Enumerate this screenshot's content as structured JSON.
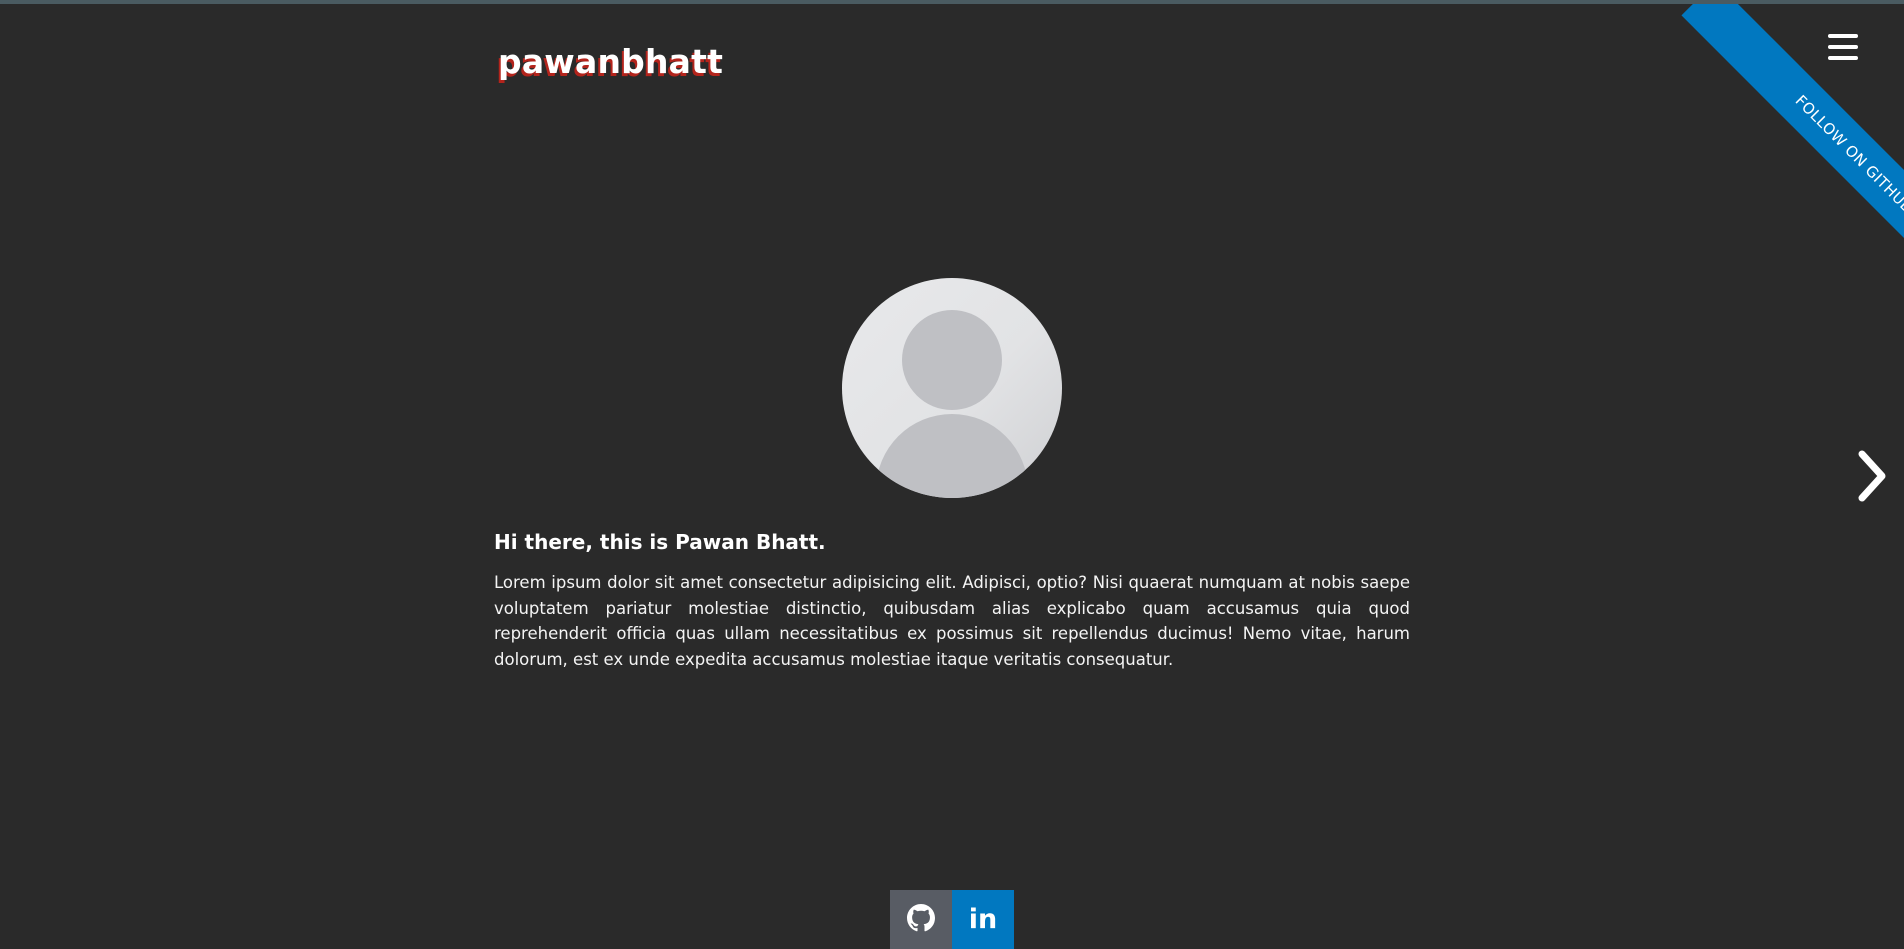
{
  "header": {
    "logo_text": "pawanbhatt",
    "menu_icon": "hamburger-menu-icon"
  },
  "ribbon": {
    "label": "FOLLOW ON GITHUB",
    "color": "#0178c0"
  },
  "hero": {
    "avatar_icon": "user-avatar-placeholder",
    "heading": "Hi there, this is Pawan Bhatt.",
    "body": "Lorem ipsum dolor sit amet consectetur adipisicing elit. Adipisci, optio? Nisi quaerat numquam at nobis saepe voluptatem pariatur molestiae distinctio, quibusdam alias explicabo quam accusamus quia quod reprehenderit officia quas ullam necessitatibus ex possimus sit repellendus ducimus! Nemo vitae, harum dolorum, est ex unde expedita accusamus molestiae itaque veritatis consequatur."
  },
  "navigation": {
    "next_icon": "chevron-right-icon"
  },
  "social": {
    "github": {
      "icon": "github-icon",
      "color": "#585c64"
    },
    "linkedin": {
      "icon": "linkedin-icon",
      "label": "in",
      "color": "#0178c0"
    }
  },
  "colors": {
    "background": "#2a2a2a",
    "logo_shadow": "#b3241c",
    "text": "#ffffff"
  }
}
